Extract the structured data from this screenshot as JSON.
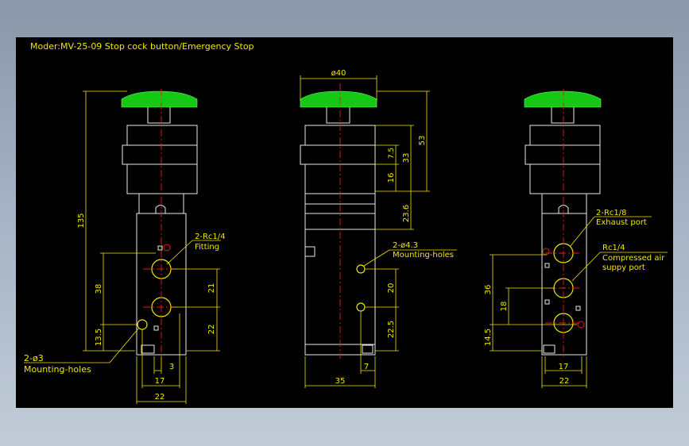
{
  "title": "Moder:MV-25-09 Stop cock button/Emergency Stop",
  "colors": {
    "background": "#000000",
    "outline": "#e8e8e8",
    "dimension": "#f2e600",
    "center_line": "#e0201c",
    "button": "#14c814"
  },
  "left_view": {
    "dims": {
      "overall_height": "135",
      "port_spacing": "21",
      "bottom_offset": "22",
      "mount_spacing": "38",
      "mount_offset": "13.5",
      "port_offset": "3",
      "port_width": "17",
      "body_width": "22"
    },
    "callouts": {
      "fitting_size": "2-Rc1/4",
      "fitting_label": "Fitting",
      "mount_size": "2-ø3",
      "mount_label": "Mounting-holes"
    }
  },
  "middle_view": {
    "dims": {
      "button_diameter": "ø40",
      "stroke": "53",
      "collar_height": "33",
      "collar_step": "7.5",
      "collar_lower": "16",
      "body_upper": "23.6",
      "hole_spacing": "20",
      "hole_offset": "22.5",
      "body_width": "35",
      "hole_edge": "7"
    },
    "callouts": {
      "mount_size": "2-ø4.3",
      "mount_label": "Mounting-holes"
    }
  },
  "right_view": {
    "dims": {
      "exhaust_spacing": "36",
      "supply_offset": "18",
      "bottom_offset": "14.5",
      "port_width": "17",
      "body_width": "22"
    },
    "callouts": {
      "exhaust_size": "2-Rc1/8",
      "exhaust_label": "Exhaust port",
      "supply_size": "Rc1/4",
      "supply_label_1": "Compressed air",
      "supply_label_2": "suppy port"
    }
  }
}
